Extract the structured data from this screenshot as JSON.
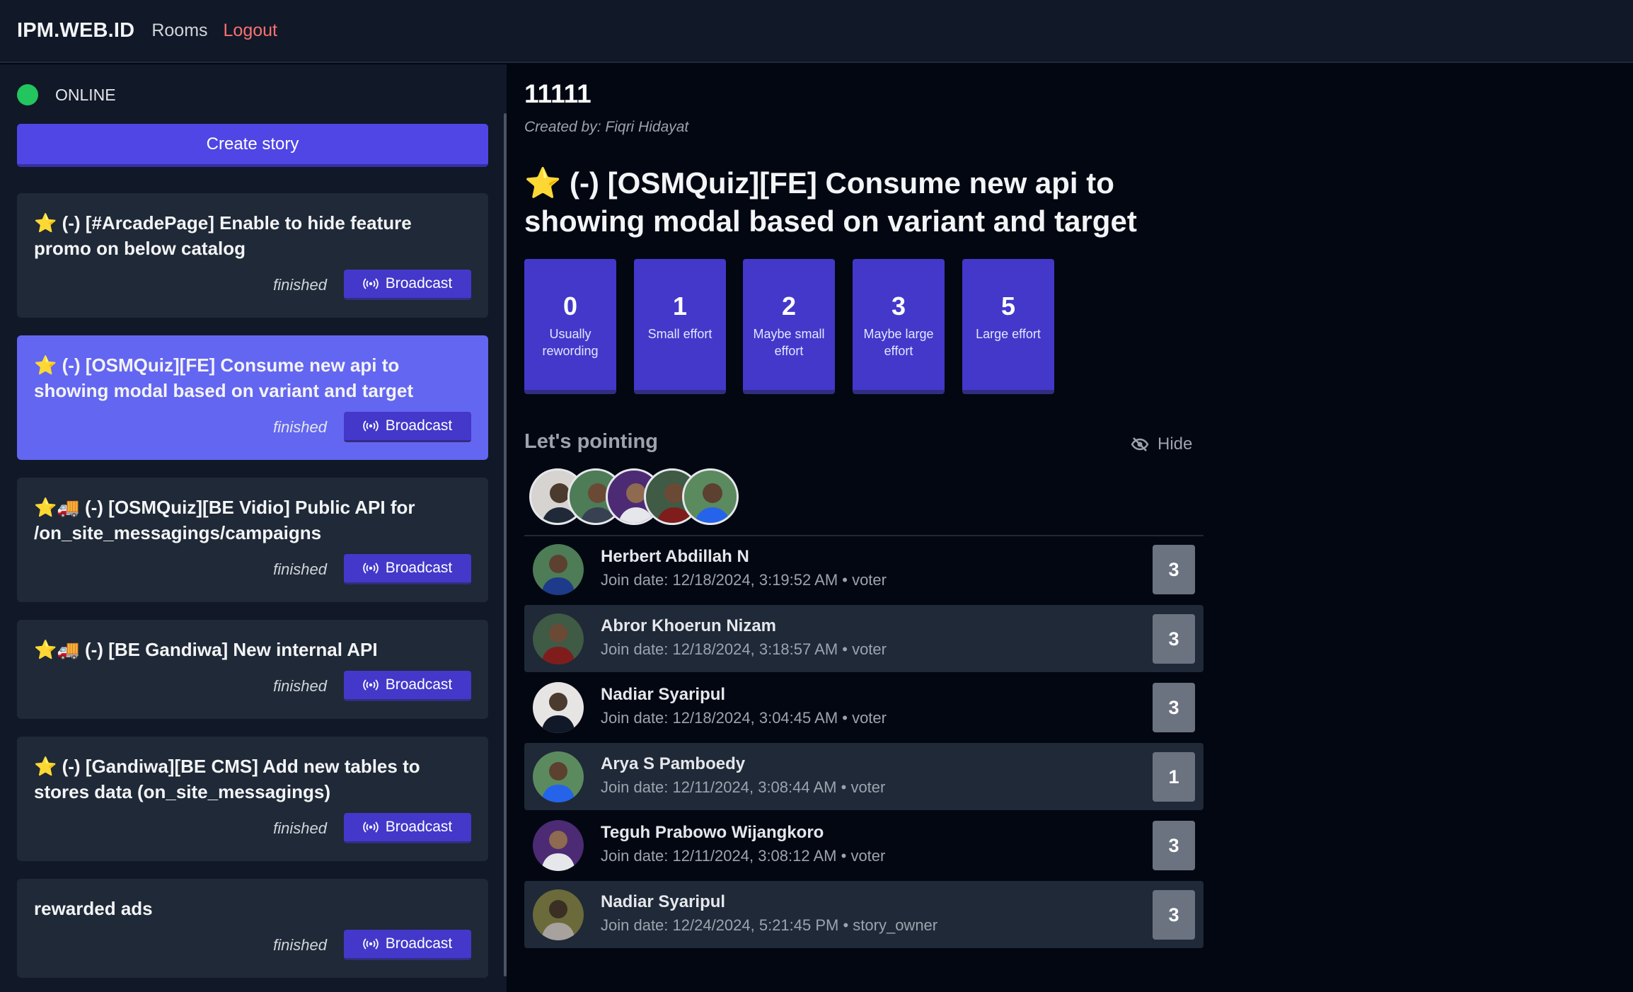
{
  "header": {
    "brand": "IPM.WEB.ID",
    "rooms_label": "Rooms",
    "logout_label": "Logout"
  },
  "sidebar": {
    "status": "ONLINE",
    "create_story_label": "Create story",
    "stories": [
      {
        "title": "⭐ (-) [#ArcadePage] Enable to hide feature promo on below catalog",
        "state": "finished",
        "broadcast": "Broadcast",
        "active": false
      },
      {
        "title": "⭐ (-) [OSMQuiz][FE] Consume new api to showing modal based on variant and target",
        "state": "finished",
        "broadcast": "Broadcast",
        "active": true
      },
      {
        "title": "⭐🚚 (-) [OSMQuiz][BE Vidio] Public API for /on_site_messagings/campaigns",
        "state": "finished",
        "broadcast": "Broadcast",
        "active": false
      },
      {
        "title": "⭐🚚 (-) [BE Gandiwa] New internal API",
        "state": "finished",
        "broadcast": "Broadcast",
        "active": false
      },
      {
        "title": "⭐ (-) [Gandiwa][BE CMS] Add new tables to stores data (on_site_messagings)",
        "state": "finished",
        "broadcast": "Broadcast",
        "active": false
      },
      {
        "title": "rewarded ads",
        "state": "finished",
        "broadcast": "Broadcast",
        "active": false
      }
    ]
  },
  "room": {
    "title": "11111",
    "created_by": "Created by: Fiqri Hidayat",
    "current_story": "⭐ (-) [OSMQuiz][FE] Consume new api to showing modal based on variant and target",
    "points": [
      {
        "value": "0",
        "label": "Usually rewording"
      },
      {
        "value": "1",
        "label": "Small effort"
      },
      {
        "value": "2",
        "label": "Maybe small effort"
      },
      {
        "value": "3",
        "label": "Maybe large effort"
      },
      {
        "value": "5",
        "label": "Large effort"
      }
    ],
    "pointing_title": "Let's pointing",
    "hide_label": "Hide",
    "voters": [
      {
        "name": "Herbert Abdillah N",
        "meta": "Join date: 12/18/2024, 3:19:52 AM • voter",
        "vote": "3"
      },
      {
        "name": "Abror Khoerun Nizam",
        "meta": "Join date: 12/18/2024, 3:18:57 AM • voter",
        "vote": "3"
      },
      {
        "name": "Nadiar Syaripul",
        "meta": "Join date: 12/18/2024, 3:04:45 AM • voter",
        "vote": "3"
      },
      {
        "name": "Arya S Pamboedy",
        "meta": "Join date: 12/11/2024, 3:08:44 AM • voter",
        "vote": "1"
      },
      {
        "name": "Teguh Prabowo Wijangkoro",
        "meta": "Join date: 12/11/2024, 3:08:12 AM • voter",
        "vote": "3"
      },
      {
        "name": "Nadiar Syaripul",
        "meta": "Join date: 12/24/2024, 5:21:45 PM • story_owner",
        "vote": "3"
      }
    ]
  },
  "colors": {
    "accent": "#4f46e5",
    "active_story": "#6366f1",
    "online": "#22c55e",
    "logout": "#f87171"
  }
}
